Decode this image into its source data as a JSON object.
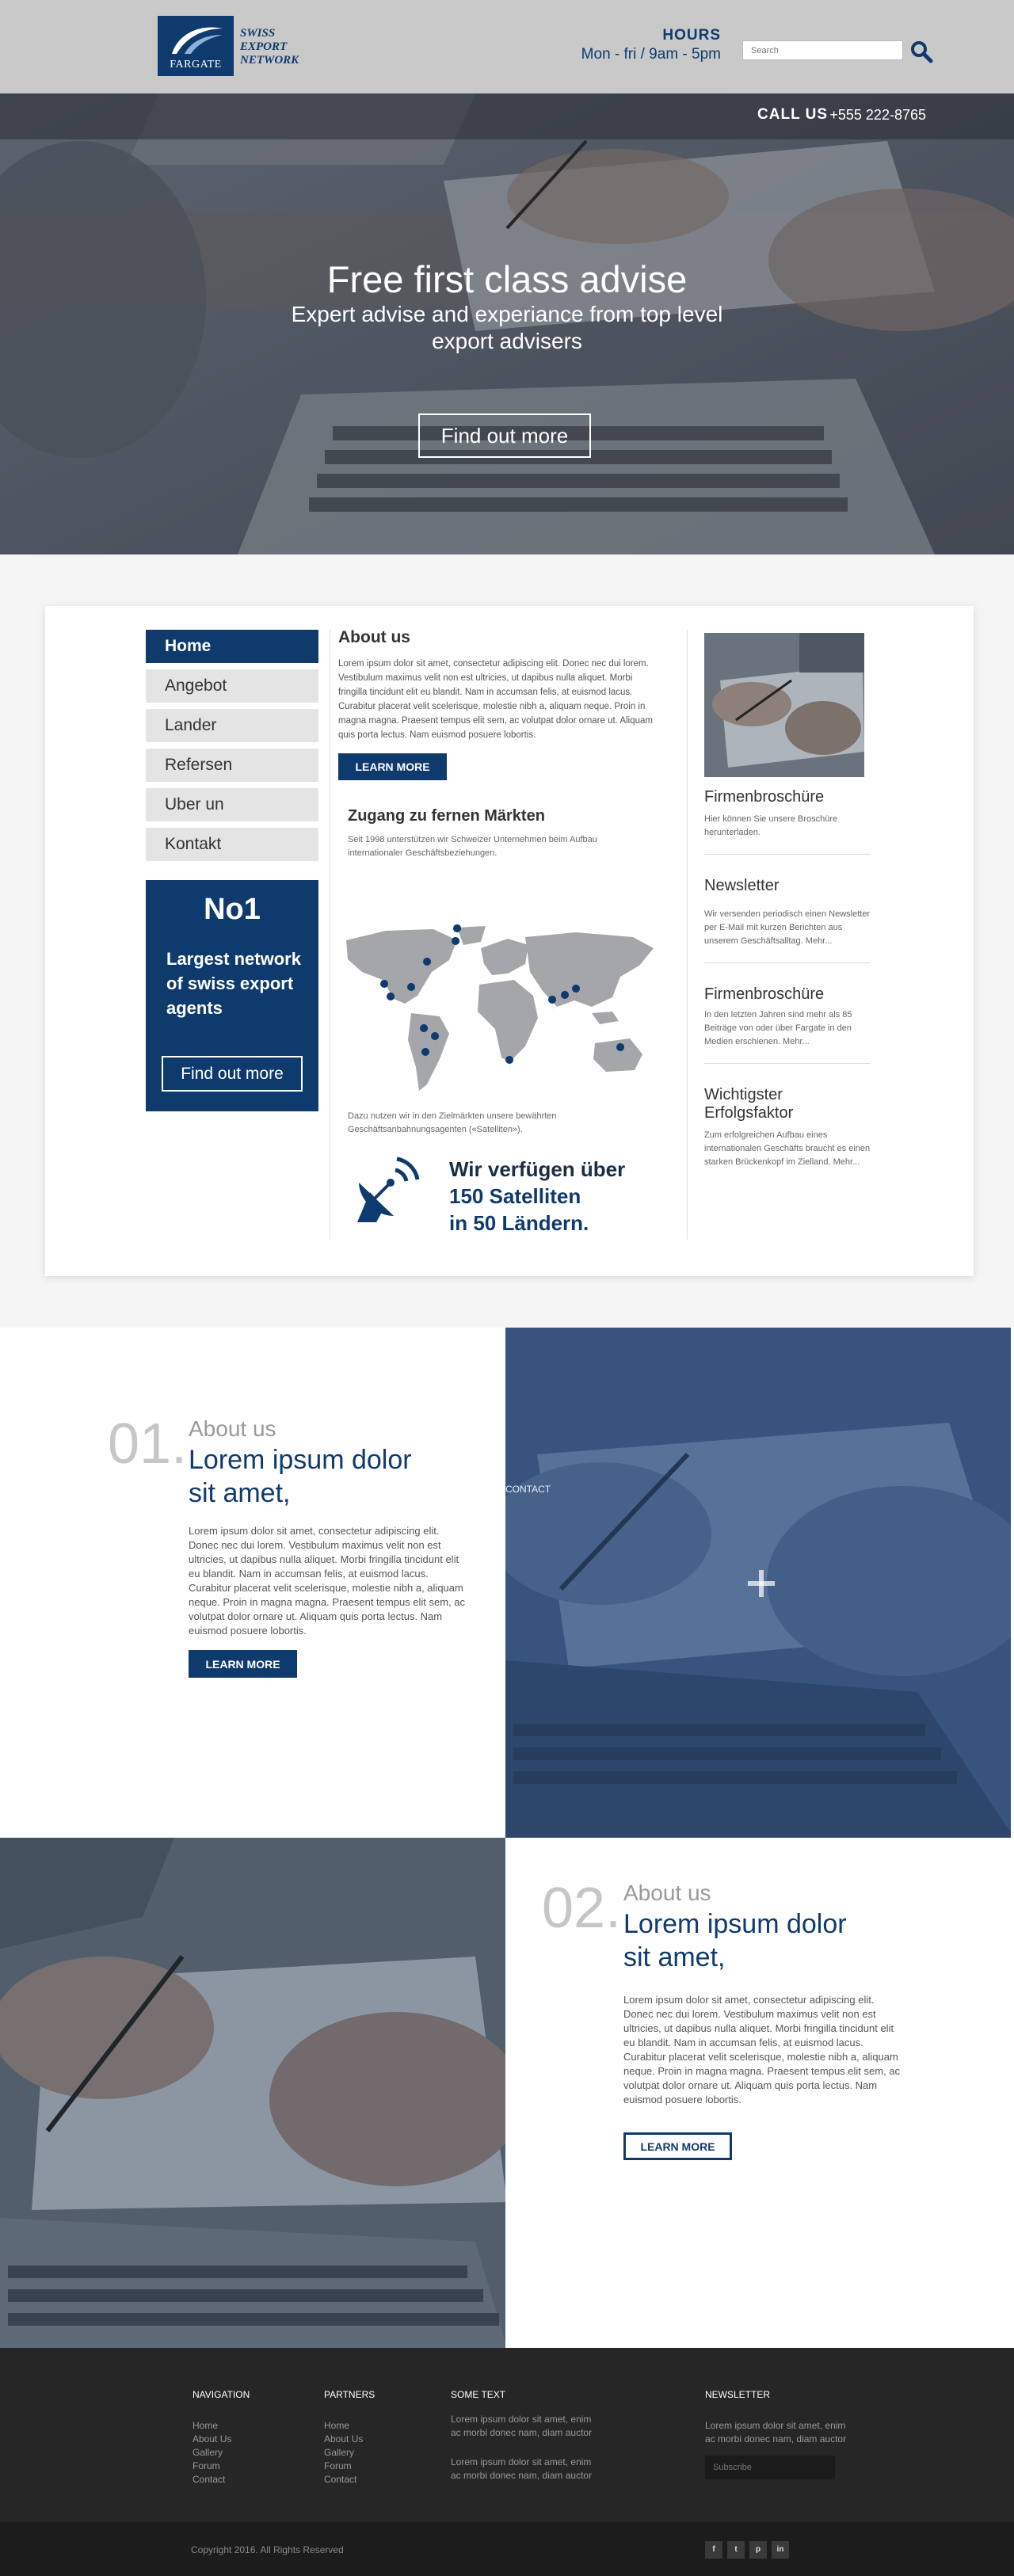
{
  "brand": {
    "logo_box_text": "FARGATE",
    "logo_lines": [
      "SWISS",
      "EXPORT",
      "NETWORK"
    ]
  },
  "header": {
    "hours_title": "HOURS",
    "hours_time": "Mon - fri / 9am - 5pm",
    "search_placeholder": "Search"
  },
  "hero": {
    "call_label": "CALL US",
    "call_number": "+555 222-8765",
    "title": "Free first class advise",
    "subtitle": "Expert advise and experiance from top level export advisers",
    "button": "Find out more"
  },
  "nav": {
    "items": [
      {
        "label": "Home",
        "active": true
      },
      {
        "label": "Angebot"
      },
      {
        "label": "Lander"
      },
      {
        "label": "Refersen"
      },
      {
        "label": "Uber un"
      },
      {
        "label": "Kontakt"
      }
    ]
  },
  "promo": {
    "number": "No1",
    "text": "Largest network of swiss export agents",
    "button": "Find out more"
  },
  "about": {
    "heading": "About us",
    "text": "Lorem ipsum dolor sit amet, consectetur adipiscing elit. Donec nec dui lorem. Vestibulum maximus velit non est ultricies, ut dapibus nulla aliquet. Morbi fringilla tincidunt elit eu blandit. Nam in accumsan felis, at euismod lacus. Curabitur placerat velit scelerisque, molestie nibh a, aliquam neque. Proin in magna magna. Praesent tempus elit sem, ac volutpat dolor ornare ut. Aliquam quis porta lectus. Nam euismod posuere lobortis.",
    "button": "LEARN MORE"
  },
  "markets": {
    "heading": "Zugang zu fernen Märkten",
    "text": "Seit 1998 unterstützen wir Schweizer Unternehmen beim Aufbau internationaler Geschäftsbeziehungen.",
    "caption": "Dazu nutzen wir in den Zielmärkten unsere bewährten Geschäftsanbahnungsagenten («Satelliten»).",
    "sat_line1": "Wir verfügen über",
    "sat_line2": "150 Satelliten",
    "sat_line3": "in 50 Ländern."
  },
  "sidebar": {
    "blocks": [
      {
        "title": "Firmenbroschüre",
        "text": "Hier können Sie unsere Broschüre herunterladen."
      },
      {
        "title": "Newsletter",
        "text": "Wir versenden periodisch einen Newsletter per E-Mail mit kurzen Berichten aus unserem Geschäftsalltag. Mehr..."
      },
      {
        "title": "Firmenbroschüre",
        "text": "In den letzten Jahren sind mehr als 85 Beiträge von oder über Fargate in den Medien erschienen. Mehr..."
      },
      {
        "title": "Wichtigster Erfolgsfaktor",
        "text": "Zum erfolgreichen Aufbau eines internationalen Geschäfts braucht es einen starken Brückenkopf im Zielland. Mehr..."
      }
    ]
  },
  "features": [
    {
      "num": "01.",
      "small": "About us",
      "title": "Lorem ipsum dolor sit amet,",
      "text": "Lorem ipsum dolor sit amet, consectetur adipiscing elit. Donec nec dui lorem. Vestibulum maximus velit non est ultricies, ut dapibus nulla aliquet. Morbi fringilla tincidunt elit eu blandit. Nam in accumsan felis, at euismod lacus. Curabitur placerat velit scelerisque, molestie nibh a, aliquam neque. Proin in magna magna. Praesent tempus elit sem, ac volutpat dolor ornare ut. Aliquam quis porta lectus. Nam euismod posuere lobortis.",
      "button": "LEARN MORE",
      "contact": "CONTACT"
    },
    {
      "num": "02.",
      "small": "About us",
      "title": "Lorem ipsum dolor sit amet,",
      "text": "Lorem ipsum dolor sit amet, consectetur adipiscing elit. Donec nec dui lorem. Vestibulum maximus velit non est ultricies, ut dapibus nulla aliquet. Morbi fringilla tincidunt elit eu blandit. Nam in accumsan felis, at euismod lacus. Curabitur placerat velit scelerisque, molestie nibh a, aliquam neque. Proin in magna magna. Praesent tempus elit sem, ac volutpat dolor ornare ut. Aliquam quis porta lectus. Nam euismod posuere lobortis.",
      "button": "LEARN MORE"
    }
  ],
  "footer": {
    "nav_heading": "NAVIGATION",
    "nav_links": [
      "Home",
      "About Us",
      "Gallery",
      "Forum",
      "Contact"
    ],
    "partners_heading": "PARTNERS",
    "partners_links": [
      "Home",
      "About Us",
      "Gallery",
      "Forum",
      "Contact"
    ],
    "some_heading": "SOME TEXT",
    "some_text_1": "Lorem ipsum dolor sit amet, enim ac morbi donec nam, diam auctor",
    "some_text_2": "Lorem ipsum dolor sit amet, enim ac morbi donec nam, diam auctor",
    "newsletter_heading": "NEWSLETTER",
    "newsletter_text": "Lorem ipsum dolor sit amet, enim ac morbi donec nam, diam auctor",
    "newsletter_placeholder": "Subscribe",
    "copyright": "Copyright 2016. All Rights Reserved",
    "social": [
      "f",
      "t",
      "p",
      "in"
    ]
  },
  "colors": {
    "brand_blue": "#0f3a6e",
    "header_gray": "#c9c9c9",
    "footer_dark": "#262626"
  }
}
